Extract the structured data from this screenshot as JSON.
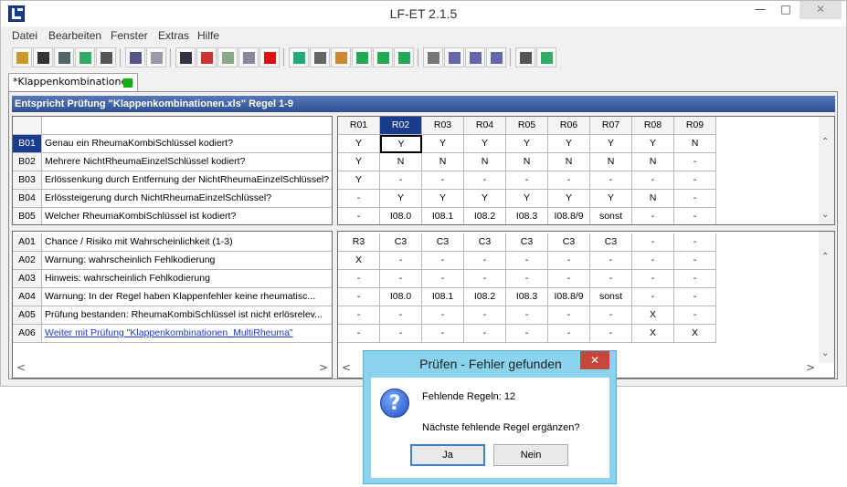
{
  "window": {
    "title": "LF-ET 2.1.5",
    "minimize_glyph": "—",
    "maximize_glyph": "□",
    "close_glyph": "✕"
  },
  "menu": [
    "Datei",
    "Bearbeiten",
    "Fenster",
    "Extras",
    "Hilfe"
  ],
  "toolbar_icons": [
    "open-folder-icon",
    "save-icon",
    "save-all-icon",
    "save-as-icon",
    "print-icon",
    "undo-icon",
    "redo-icon",
    "cut-icon",
    "copy-icon",
    "paste-icon",
    "paste-special-icon",
    "delete-icon",
    "insert-rule-icon",
    "stamp-icon",
    "filter-icon",
    "grid-check-icon",
    "grid-add-icon",
    "grid-verify-icon",
    "arrow-up-icon",
    "arrow-down-icon",
    "arrow-left-icon",
    "arrow-right-icon",
    "camera-icon",
    "export-icon"
  ],
  "tab": {
    "label": "*Klappenkombinationen",
    "status_color": "#11b011"
  },
  "table": {
    "header": "Entspricht Prüfung \"Klappenkombinationen.xls\" Regel 1-9",
    "rules": [
      "R01",
      "R02",
      "R03",
      "R04",
      "R05",
      "R06",
      "R07",
      "R08",
      "R09"
    ],
    "selected_rule": 1,
    "conditions": [
      {
        "id": "B01",
        "text": "Genau ein RheumaKombiSchlüssel kodiert?",
        "values": [
          "Y",
          "Y",
          "Y",
          "Y",
          "Y",
          "Y",
          "Y",
          "Y",
          "N"
        ]
      },
      {
        "id": "B02",
        "text": "Mehrere NichtRheumaEinzelSchlüssel kodiert?",
        "values": [
          "Y",
          "N",
          "N",
          "N",
          "N",
          "N",
          "N",
          "N",
          "-"
        ]
      },
      {
        "id": "B03",
        "text": "Erlössenkung durch Entfernung der NichtRheumaEinzelSchlüssel?",
        "values": [
          "Y",
          "-",
          "-",
          "-",
          "-",
          "-",
          "-",
          "-",
          "-"
        ]
      },
      {
        "id": "B04",
        "text": "Erlössteigerung durch NichtRheumaEinzelSchlüssel?",
        "values": [
          "-",
          "Y",
          "Y",
          "Y",
          "Y",
          "Y",
          "Y",
          "N",
          "-"
        ]
      },
      {
        "id": "B05",
        "text": "Welcher RheumaKombiSchlüssel ist kodiert?",
        "values": [
          "-",
          "I08.0",
          "I08.1",
          "I08.2",
          "I08.3",
          "I08.8/9",
          "sonst",
          "-",
          "-"
        ]
      }
    ],
    "actions": [
      {
        "id": "A01",
        "text": "Chance / Risiko mit Wahrscheinlichkeit (1-3)",
        "values": [
          "R3",
          "C3",
          "C3",
          "C3",
          "C3",
          "C3",
          "C3",
          "-",
          "-"
        ]
      },
      {
        "id": "A02",
        "text": "Warnung: wahrscheinlich Fehlkodierung",
        "values": [
          "X",
          "-",
          "-",
          "-",
          "-",
          "-",
          "-",
          "-",
          "-"
        ]
      },
      {
        "id": "A03",
        "text": "Hinweis: wahrscheinlich Fehlkodierung",
        "values": [
          "-",
          "-",
          "-",
          "-",
          "-",
          "-",
          "-",
          "-",
          "-"
        ]
      },
      {
        "id": "A04",
        "text": "Warnung: In der Regel haben Klappenfehler keine rheumatisc...",
        "values": [
          "-",
          "I08.0",
          "I08.1",
          "I08.2",
          "I08.3",
          "I08.8/9",
          "sonst",
          "-",
          "-"
        ]
      },
      {
        "id": "A05",
        "text": "Prüfung bestanden: RheumaKombiSchlüssel ist nicht erlösrelev...",
        "values": [
          "-",
          "-",
          "-",
          "-",
          "-",
          "-",
          "-",
          "X",
          "-"
        ]
      },
      {
        "id": "A06",
        "text": "Weiter mit Prüfung \"Klappenkombinationen_MultiRheuma\"",
        "values": [
          "-",
          "-",
          "-",
          "-",
          "-",
          "-",
          "-",
          "X",
          "X"
        ],
        "is_link": true
      }
    ]
  },
  "dialog": {
    "title": "Prüfen - Fehler gefunden",
    "close_glyph": "✕",
    "icon_glyph": "?",
    "message1": "Fehlende Regeln: 12",
    "message2": "Nächste fehlende Regel ergänzen?",
    "yes_label": "Ja",
    "no_label": "Nein"
  },
  "scroll_glyphs": {
    "up": "⌃",
    "down": "⌄",
    "left": "<",
    "right": ">"
  }
}
